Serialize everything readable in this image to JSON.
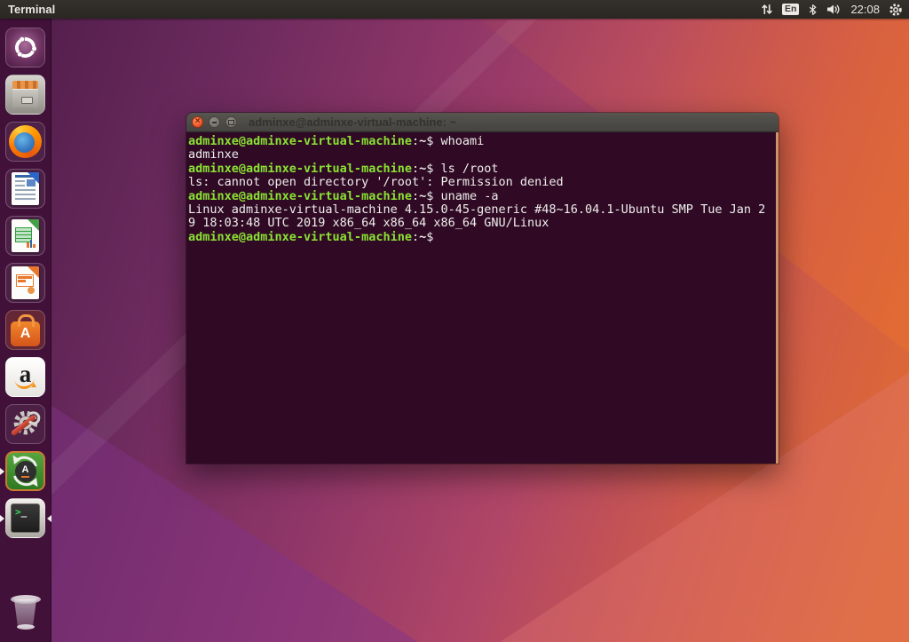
{
  "top_bar": {
    "app_name": "Terminal",
    "keyboard_layout": "En",
    "clock": "22:08",
    "icons": [
      "network-traffic-icon",
      "keyboard-layout-indicator",
      "bluetooth-icon",
      "volume-icon",
      "session-gear-icon"
    ]
  },
  "launcher": {
    "items": [
      {
        "label": "Ubuntu Dash",
        "icon": "ubuntu-dash-icon"
      },
      {
        "label": "Files",
        "icon": "files-icon"
      },
      {
        "label": "Firefox",
        "icon": "firefox-icon"
      },
      {
        "label": "LibreOffice Writer",
        "icon": "libreoffice-writer-icon"
      },
      {
        "label": "LibreOffice Calc",
        "icon": "libreoffice-calc-icon"
      },
      {
        "label": "LibreOffice Impress",
        "icon": "libreoffice-impress-icon"
      },
      {
        "label": "Ubuntu Software",
        "icon": "ubuntu-software-icon"
      },
      {
        "label": "Amazon",
        "icon": "amazon-icon"
      },
      {
        "label": "System Settings",
        "icon": "system-settings-icon"
      },
      {
        "label": "Software Updater",
        "icon": "software-updater-icon",
        "running": true
      },
      {
        "label": "Terminal",
        "icon": "terminal-icon",
        "running": true,
        "focused": true
      },
      {
        "label": "Trash",
        "icon": "trash-icon"
      }
    ],
    "glyphs": {
      "software_letter": "A",
      "amazon_letter": "a",
      "updater_letter": "A",
      "terminal_gt": ">",
      "terminal_underscore": "_"
    }
  },
  "window": {
    "title": "adminxe@adminxe-virtual-machine: ~",
    "buttons": [
      "close",
      "minimize",
      "maximize"
    ]
  },
  "terminal": {
    "colors": {
      "background": "#300a24",
      "prompt_green": "#8ae234",
      "text": "#eeeeec",
      "scrollbar": "#eaa976"
    },
    "lines": [
      {
        "segments": [
          [
            "prompt",
            "adminxe@adminxe-virtual-machine"
          ],
          [
            "plain",
            ":"
          ],
          [
            "path",
            "~"
          ],
          [
            "plain",
            "$ "
          ],
          [
            "cmd",
            "whoami"
          ]
        ]
      },
      {
        "segments": [
          [
            "plain",
            "adminxe"
          ]
        ]
      },
      {
        "segments": [
          [
            "prompt",
            "adminxe@adminxe-virtual-machine"
          ],
          [
            "plain",
            ":"
          ],
          [
            "path",
            "~"
          ],
          [
            "plain",
            "$ "
          ],
          [
            "cmd",
            "ls /root"
          ]
        ]
      },
      {
        "segments": [
          [
            "plain",
            "ls: cannot open directory '/root': Permission denied"
          ]
        ]
      },
      {
        "segments": [
          [
            "prompt",
            "adminxe@adminxe-virtual-machine"
          ],
          [
            "plain",
            ":"
          ],
          [
            "path",
            "~"
          ],
          [
            "plain",
            "$ "
          ],
          [
            "cmd",
            "uname -a"
          ]
        ]
      },
      {
        "segments": [
          [
            "plain",
            "Linux adminxe-virtual-machine 4.15.0-45-generic #48~16.04.1-Ubuntu SMP Tue Jan 2"
          ]
        ]
      },
      {
        "segments": [
          [
            "plain",
            "9 18:03:48 UTC 2019 x86_64 x86_64 x86_64 GNU/Linux"
          ]
        ]
      },
      {
        "segments": [
          [
            "prompt",
            "adminxe@adminxe-virtual-machine"
          ],
          [
            "plain",
            ":"
          ],
          [
            "path",
            "~"
          ],
          [
            "plain",
            "$ "
          ]
        ]
      }
    ]
  }
}
